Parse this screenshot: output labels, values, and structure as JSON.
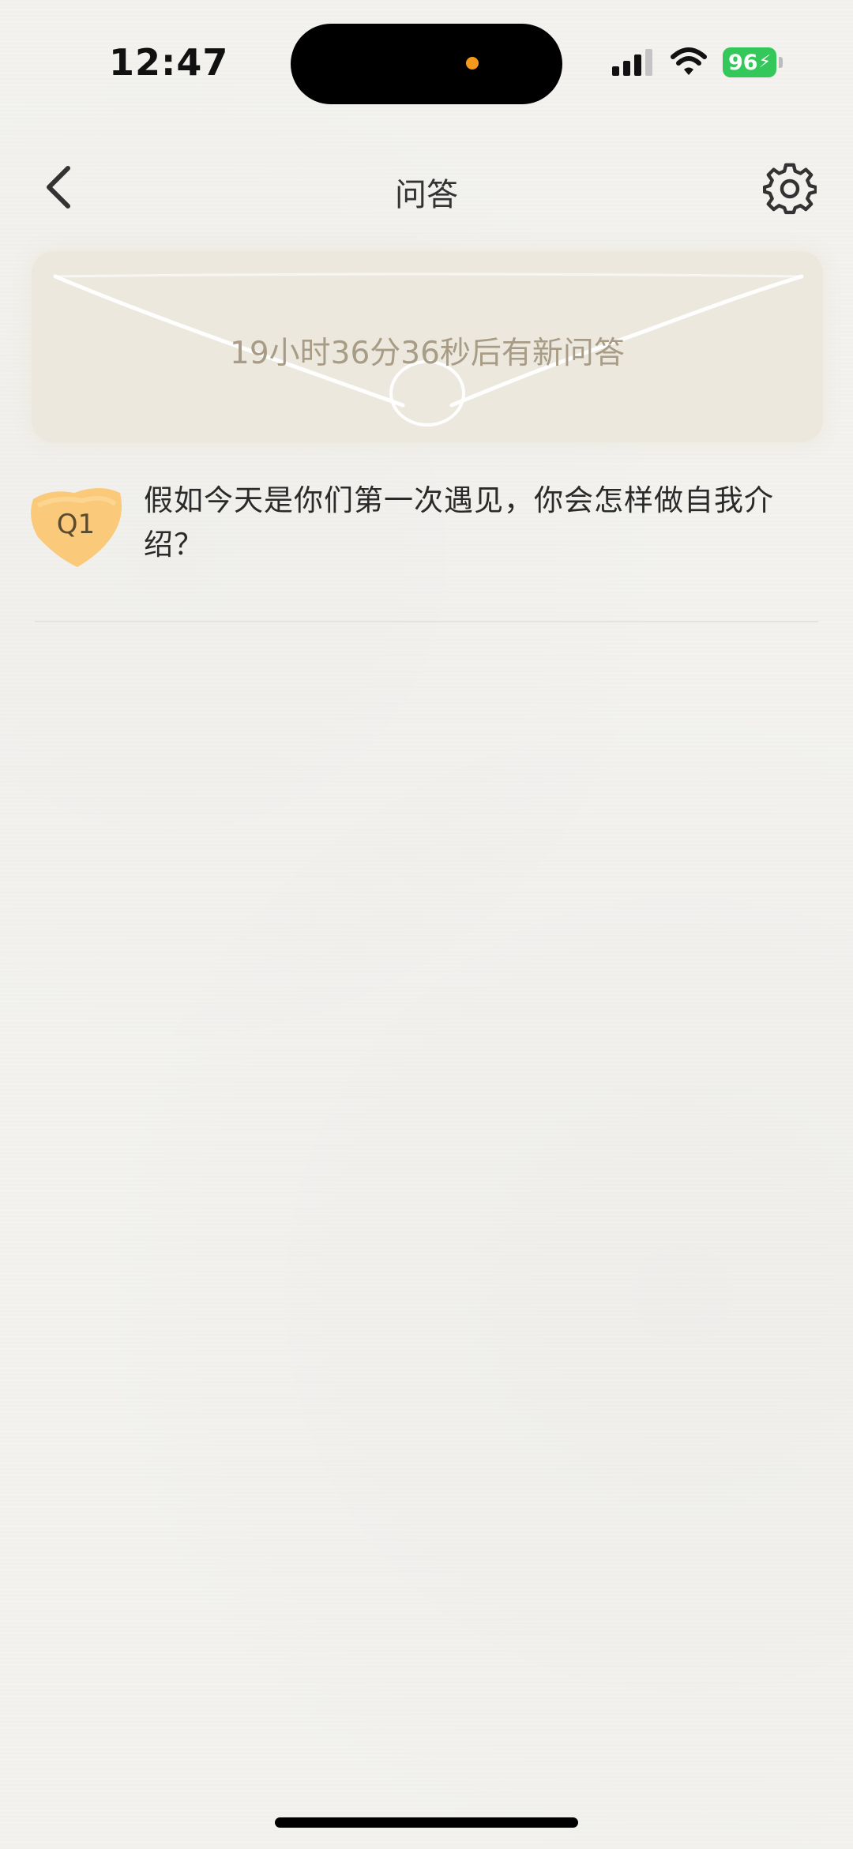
{
  "status_bar": {
    "time": "12:47",
    "battery_level": "96"
  },
  "nav": {
    "title": "问答"
  },
  "envelope": {
    "countdown": "19小时36分36秒后有新问答"
  },
  "question": {
    "badge": "Q1",
    "text": "假如今天是你们第一次遇见，你会怎样做自我介绍？"
  },
  "colors": {
    "background": "#f3f2ef",
    "envelope": "#ece8de",
    "badge": "#fbc66f",
    "battery": "#34c759"
  }
}
